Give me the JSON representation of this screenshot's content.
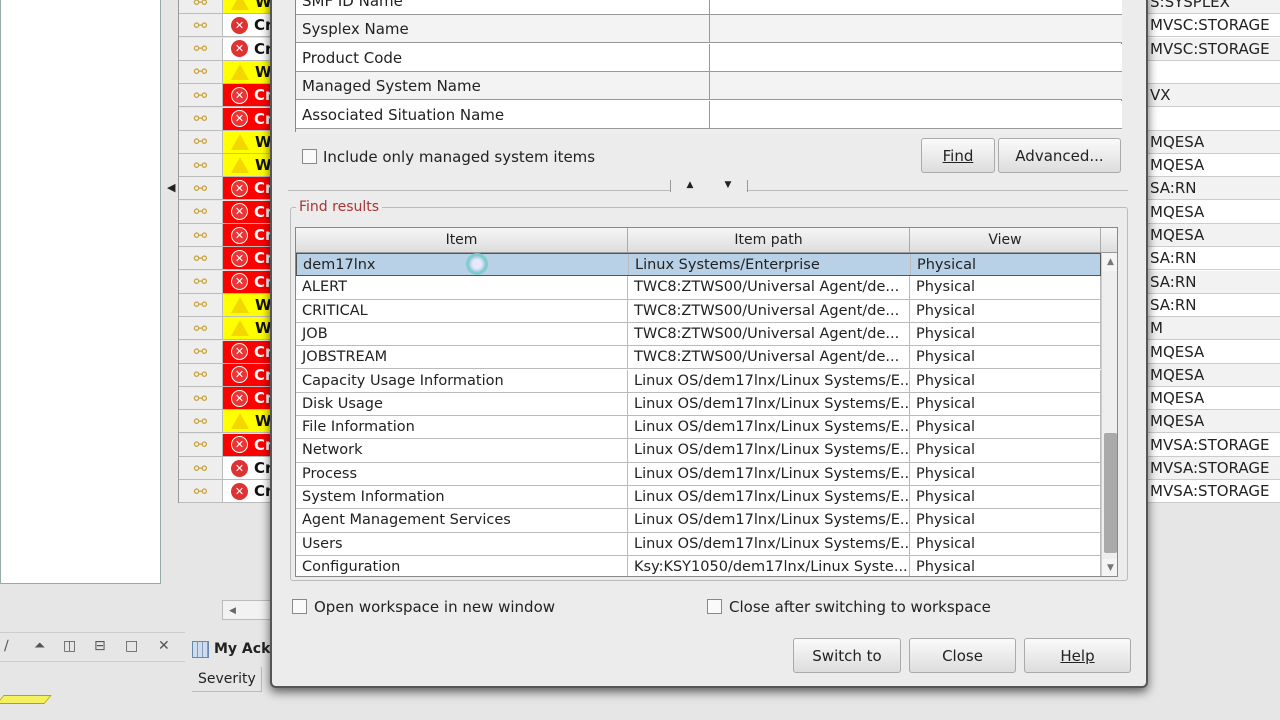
{
  "background": {
    "alerts": [
      {
        "severity": "warning",
        "label": "W"
      },
      {
        "severity": "critical-plain",
        "label": "Cr"
      },
      {
        "severity": "critical-plain",
        "label": "Cr"
      },
      {
        "severity": "warning",
        "label": "W"
      },
      {
        "severity": "critical",
        "label": "Cr"
      },
      {
        "severity": "critical",
        "label": "Cr"
      },
      {
        "severity": "warning",
        "label": "W"
      },
      {
        "severity": "warning",
        "label": "W"
      },
      {
        "severity": "critical",
        "label": "Cr"
      },
      {
        "severity": "critical",
        "label": "Cr"
      },
      {
        "severity": "critical",
        "label": "Cr"
      },
      {
        "severity": "critical",
        "label": "Cr"
      },
      {
        "severity": "critical",
        "label": "Cr"
      },
      {
        "severity": "warning",
        "label": "W"
      },
      {
        "severity": "warning",
        "label": "W"
      },
      {
        "severity": "critical",
        "label": "Cr"
      },
      {
        "severity": "critical",
        "label": "Cr"
      },
      {
        "severity": "critical",
        "label": "Cr"
      },
      {
        "severity": "warning",
        "label": "W"
      },
      {
        "severity": "critical",
        "label": "Cr"
      },
      {
        "severity": "critical-plain",
        "label": "Cr"
      },
      {
        "severity": "critical-plain",
        "label": "Cr"
      }
    ],
    "right_column": [
      "S:SYSPLEX",
      "MVSC:STORAGE",
      "MVSC:STORAGE",
      "",
      "VX",
      "",
      "MQESA",
      "MQESA",
      "SA:RN",
      "MQESA",
      "MQESA",
      "SA:RN",
      "SA:RN",
      "SA:RN",
      "M",
      "MQESA",
      "MQESA",
      "MQESA",
      "MQESA",
      "MVSA:STORAGE",
      "MVSA:STORAGE",
      "MVSA:STORAGE"
    ],
    "bottom_tab": "My Ack",
    "severity_header": "Severity",
    "colors": {
      "warning": "#ffff00",
      "critical": "#ff0000",
      "selection": "#b9d1e6",
      "group_legend": "#a33333"
    }
  },
  "dialog": {
    "criteria": [
      "SMF ID Name",
      "Sysplex Name",
      "Product Code",
      "Managed System Name",
      "Associated Situation Name"
    ],
    "include_managed_label": "Include only managed system items",
    "find_label": "Find",
    "advanced_label": "Advanced...",
    "results_legend": "Find results",
    "columns": [
      "Item",
      "Item path",
      "View"
    ],
    "rows": [
      {
        "item": "dem17lnx",
        "path": "Linux Systems/Enterprise",
        "view": "Physical",
        "selected": true
      },
      {
        "item": "ALERT",
        "path": "TWC8:ZTWS00/Universal Agent/de...",
        "view": "Physical"
      },
      {
        "item": "CRITICAL",
        "path": "TWC8:ZTWS00/Universal Agent/de...",
        "view": "Physical"
      },
      {
        "item": "JOB",
        "path": "TWC8:ZTWS00/Universal Agent/de...",
        "view": "Physical"
      },
      {
        "item": "JOBSTREAM",
        "path": "TWC8:ZTWS00/Universal Agent/de...",
        "view": "Physical"
      },
      {
        "item": "Capacity Usage Information",
        "path": "Linux OS/dem17lnx/Linux Systems/E...",
        "view": "Physical"
      },
      {
        "item": "Disk Usage",
        "path": "Linux OS/dem17lnx/Linux Systems/E...",
        "view": "Physical"
      },
      {
        "item": "File Information",
        "path": "Linux OS/dem17lnx/Linux Systems/E...",
        "view": "Physical"
      },
      {
        "item": "Network",
        "path": "Linux OS/dem17lnx/Linux Systems/E...",
        "view": "Physical"
      },
      {
        "item": "Process",
        "path": "Linux OS/dem17lnx/Linux Systems/E...",
        "view": "Physical"
      },
      {
        "item": "System Information",
        "path": "Linux OS/dem17lnx/Linux Systems/E...",
        "view": "Physical"
      },
      {
        "item": "Agent Management Services",
        "path": "Linux OS/dem17lnx/Linux Systems/E...",
        "view": "Physical"
      },
      {
        "item": "Users",
        "path": "Linux OS/dem17lnx/Linux Systems/E...",
        "view": "Physical"
      },
      {
        "item": "Configuration",
        "path": "Ksy:KSY1050/dem17lnx/Linux Syste...",
        "view": "Physical"
      }
    ],
    "open_new_window_label": "Open workspace in new window",
    "close_after_label": "Close after switching to workspace",
    "switch_to_label": "Switch to",
    "close_label": "Close",
    "help_label": "Help"
  }
}
